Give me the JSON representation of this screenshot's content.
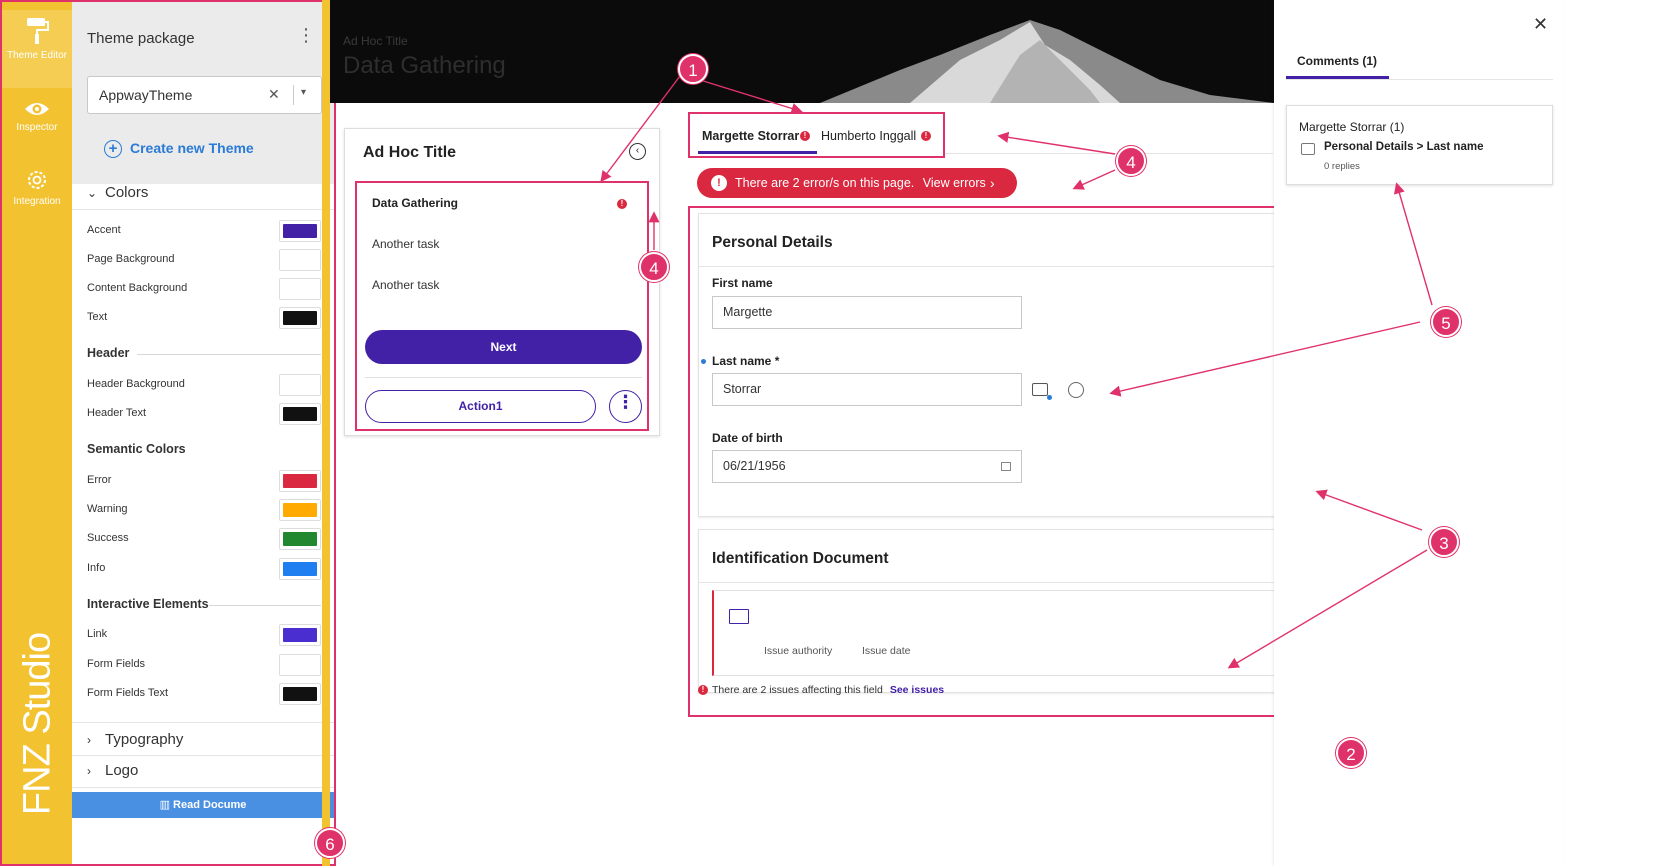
{
  "rail": {
    "items": [
      {
        "label": "Theme Editor",
        "icon": "paint-roller-icon"
      },
      {
        "label": "Inspector",
        "icon": "eye-icon"
      },
      {
        "label": "Integration",
        "icon": "gear-icon"
      }
    ],
    "brand": "FNZ Studio"
  },
  "theme_panel": {
    "title": "Theme package",
    "selected_theme": "AppwayTheme",
    "create_label": "Create new Theme",
    "colors_label": "Colors",
    "colors": [
      {
        "label": "Accent",
        "color": "#4321a6"
      },
      {
        "label": "Page Background",
        "color": "#ffffff"
      },
      {
        "label": "Content Background",
        "color": "#ffffff"
      },
      {
        "label": "Text",
        "color": "#111111"
      }
    ],
    "header_label": "Header",
    "header": [
      {
        "label": "Header Background",
        "color": "#ffffff"
      },
      {
        "label": "Header Text",
        "color": "#111111"
      }
    ],
    "semantic_label": "Semantic Colors",
    "semantic": [
      {
        "label": "Error",
        "color": "#d9283f"
      },
      {
        "label": "Warning",
        "color": "#ffaa00"
      },
      {
        "label": "Success",
        "color": "#22882f"
      },
      {
        "label": "Info",
        "color": "#1f7ef0"
      }
    ],
    "interactive_label": "Interactive Elements",
    "interactive": [
      {
        "label": "Link",
        "color": "#4a2ed0"
      },
      {
        "label": "Form Fields",
        "color": "#ffffff"
      },
      {
        "label": "Form Fields Text",
        "color": "#111111"
      }
    ],
    "typography_label": "Typography",
    "logo_label": "Logo",
    "read_doc_label": "Read Docume"
  },
  "hero": {
    "breadcrumb": "Ad Hoc Title",
    "title": "Data Gathering"
  },
  "task_card": {
    "title": "Ad Hoc Title",
    "tasks": [
      "Data Gathering",
      "Another task",
      "Another task"
    ],
    "next_label": "Next",
    "action_label": "Action1"
  },
  "tabs": [
    {
      "label": "Margette Storrar",
      "active": true
    },
    {
      "label": "Humberto Inggall",
      "active": false
    }
  ],
  "error_banner": {
    "text": "There are 2 error/s on this page.",
    "link": "View errors"
  },
  "personal": {
    "title": "Personal Details",
    "first_name_label": "First name",
    "first_name_value": "Margette",
    "last_name_label": "Last name *",
    "last_name_value": "Storrar",
    "dob_label": "Date of birth",
    "dob_value": "06/21/1956"
  },
  "identification": {
    "title": "Identification Document",
    "issue_authority_label": "Issue authority",
    "issue_date_label": "Issue date",
    "issues_text": "There are 2 issues affecting this field",
    "see_issues": "See issues"
  },
  "comments": {
    "tab_label": "Comments (1)",
    "author": "Margette Storrar (1)",
    "target": "Personal Details > Last name",
    "replies": "0 replies"
  },
  "callouts": [
    "1",
    "2",
    "3",
    "4",
    "4",
    "5",
    "6"
  ],
  "accent_color": "#e0326a"
}
